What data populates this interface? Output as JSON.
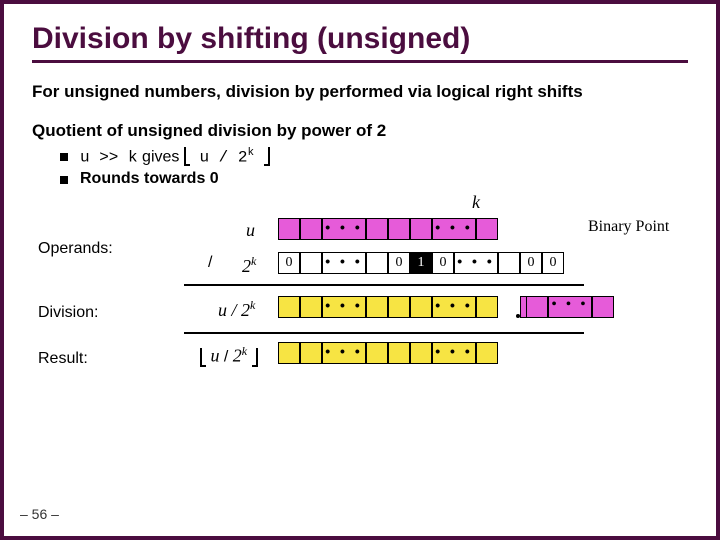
{
  "title": "Division by shifting (unsigned)",
  "body1": "For unsigned numbers, division by performed via logical right shifts",
  "body2": "Quotient of unsigned division by power of 2",
  "bullet1_pre": "u >> k",
  "bullet1_mid": " gives ",
  "bullet1_expr_inner": " u / 2",
  "bullet1_k": "k",
  "bullet2": "Rounds towards 0",
  "labels": {
    "k": "k",
    "binary_point": "Binary Point",
    "operands": "Operands:",
    "division": "Division:",
    "result": "Result:",
    "u": "u",
    "two_k": "2",
    "two_k_sup": "k",
    "u_over_2k": "u / 2",
    "slash": "/",
    "zero": "0",
    "one": "1",
    "dots": "• • •",
    "dot_char": "."
  },
  "page": "– 56 –"
}
